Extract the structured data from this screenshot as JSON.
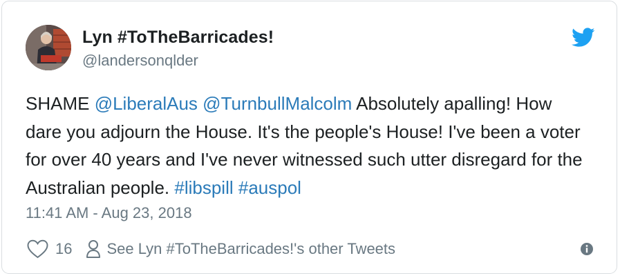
{
  "author": {
    "display_name": "Lyn #ToTheBarricades!",
    "handle": "@landersonqlder",
    "avatar_icon": "profile-photo"
  },
  "tweet": {
    "segments": [
      {
        "text": "SHAME ",
        "kind": "text"
      },
      {
        "text": "@LiberalAus",
        "kind": "mention"
      },
      {
        "text": " ",
        "kind": "text"
      },
      {
        "text": "@TurnbullMalcolm",
        "kind": "mention"
      },
      {
        "text": " Absolutely apalling! How dare you adjourn the House. It's the people's House! I've been a voter for over 40 years and I've never witnessed such utter disregard for the Australian people. ",
        "kind": "text"
      },
      {
        "text": "#libspill",
        "kind": "hashtag"
      },
      {
        "text": " ",
        "kind": "text"
      },
      {
        "text": "#auspol",
        "kind": "hashtag"
      }
    ],
    "timestamp": "11:41 AM - Aug 23, 2018"
  },
  "actions": {
    "like_count": "16",
    "profile_link": "See Lyn #ToTheBarricades!'s other Tweets"
  },
  "icons": {
    "brand": "twitter-bird-icon",
    "like": "heart-icon",
    "profile": "person-icon",
    "info": "info-icon"
  },
  "colors": {
    "text": "#1c2022",
    "secondary": "#697882",
    "link": "#2b7bb9",
    "brand": "#1da1f2",
    "border": "#d9dde0"
  }
}
